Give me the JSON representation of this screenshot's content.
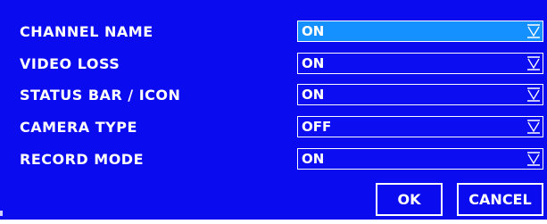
{
  "dialog": {
    "title_fragment": "'' '"
  },
  "settings": [
    {
      "label": "CHANNEL NAME",
      "value": "ON",
      "focused": true
    },
    {
      "label": "VIDEO LOSS",
      "value": "ON",
      "focused": false
    },
    {
      "label": "STATUS BAR / ICON",
      "value": "ON",
      "focused": false
    },
    {
      "label": "CAMERA TYPE",
      "value": "OFF",
      "focused": false
    },
    {
      "label": "RECORD MODE",
      "value": "ON",
      "focused": false
    }
  ],
  "buttons": {
    "ok_label": "OK",
    "cancel_label": "CANCEL"
  },
  "icons": {
    "dropdown": "dropdown-arrow-icon"
  },
  "colors": {
    "background": "#0b0bf0",
    "focused_field": "#1590ff",
    "text": "#ffffff"
  }
}
